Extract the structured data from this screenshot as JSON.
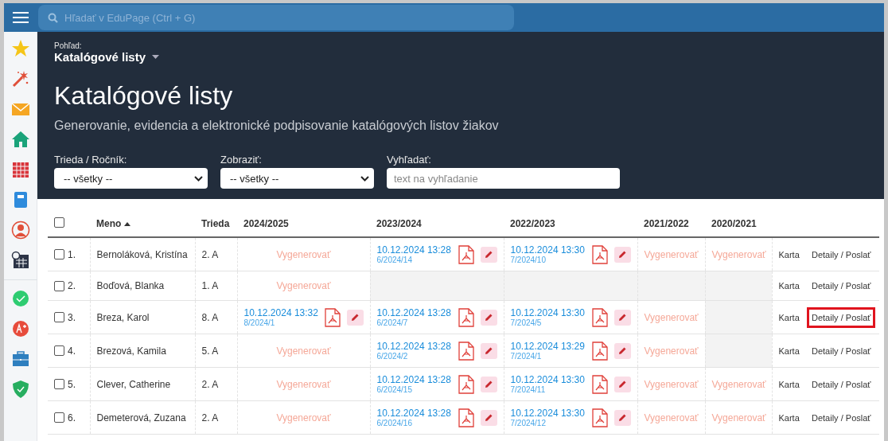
{
  "search": {
    "placeholder": "Hľadať v EduPage (Ctrl + G)"
  },
  "view": {
    "label": "Pohľad:",
    "value": "Katalógové listy"
  },
  "title": "Katalógové listy",
  "subtitle": "Generovanie, evidencia a elektronické podpisovanie katalógových listov žiakov",
  "filters": [
    {
      "kind": "select",
      "label": "Trieda / Ročník:",
      "value": "-- všetky --"
    },
    {
      "kind": "select",
      "label": "Zobraziť:",
      "value": "-- všetky --"
    },
    {
      "kind": "text",
      "label": "Vyhľadať:",
      "placeholder": "text na vyhľadanie"
    }
  ],
  "table": {
    "select_all": {
      "checked": false
    },
    "columns": [
      {
        "label": "Meno",
        "sorted": true
      },
      {
        "label": "Trieda",
        "sorted": false
      },
      {
        "label": "2024/2025",
        "sorted": false
      },
      {
        "label": "2023/2024",
        "sorted": false
      },
      {
        "label": "2022/2023",
        "sorted": false
      },
      {
        "label": "2021/2022",
        "sorted": false
      },
      {
        "label": "2020/2021",
        "sorted": false
      }
    ],
    "rows": [
      {
        "checked": false,
        "number": "1.",
        "name": "Bernoláková, Kristína",
        "class": "2. A",
        "years": [
          {
            "kind": "generate",
            "text": "Vygenerovať"
          },
          {
            "kind": "signed",
            "date": "10.12.2024 13:28",
            "ref": "6/2024/14"
          },
          {
            "kind": "signed",
            "date": "10.12.2024 13:30",
            "ref": "7/2024/10"
          },
          {
            "kind": "generate",
            "text": "Vygenerovať"
          },
          {
            "kind": "generate",
            "text": "Vygenerovať"
          }
        ],
        "card": "Karta",
        "details": "Detaily / Poslať",
        "highlighted": false
      },
      {
        "checked": false,
        "number": "2.",
        "name": "Boďová, Blanka",
        "class": "1. A",
        "years": [
          {
            "kind": "generate",
            "text": "Vygenerovať"
          },
          {
            "kind": "empty"
          },
          {
            "kind": "empty"
          },
          {
            "kind": "empty"
          },
          {
            "kind": "empty"
          }
        ],
        "card": "Karta",
        "details": "Detaily / Poslať",
        "highlighted": false
      },
      {
        "checked": false,
        "number": "3.",
        "name": "Breza, Karol",
        "class": "8. A",
        "years": [
          {
            "kind": "signed",
            "date": "10.12.2024 13:32",
            "ref": "8/2024/1"
          },
          {
            "kind": "signed",
            "date": "10.12.2024 13:28",
            "ref": "6/2024/7"
          },
          {
            "kind": "signed",
            "date": "10.12.2024 13:30",
            "ref": "7/2024/5"
          },
          {
            "kind": "generate",
            "text": "Vygenerovať"
          },
          {
            "kind": "empty"
          }
        ],
        "card": "Karta",
        "details": "Detaily / Poslať",
        "highlighted": true
      },
      {
        "checked": false,
        "number": "4.",
        "name": "Brezová, Kamila",
        "class": "5. A",
        "years": [
          {
            "kind": "generate",
            "text": "Vygenerovať"
          },
          {
            "kind": "signed",
            "date": "10.12.2024 13:28",
            "ref": "6/2024/2"
          },
          {
            "kind": "signed",
            "date": "10.12.2024 13:29",
            "ref": "7/2024/1"
          },
          {
            "kind": "generate",
            "text": "Vygenerovať"
          },
          {
            "kind": "empty"
          }
        ],
        "card": "Karta",
        "details": "Detaily / Poslať",
        "highlighted": false
      },
      {
        "checked": false,
        "number": "5.",
        "name": "Clever, Catherine",
        "class": "2. A",
        "years": [
          {
            "kind": "generate",
            "text": "Vygenerovať"
          },
          {
            "kind": "signed",
            "date": "10.12.2024 13:28",
            "ref": "6/2024/15"
          },
          {
            "kind": "signed",
            "date": "10.12.2024 13:30",
            "ref": "7/2024/11"
          },
          {
            "kind": "generate",
            "text": "Vygenerovať"
          },
          {
            "kind": "generate",
            "text": "Vygenerovať"
          }
        ],
        "card": "Karta",
        "details": "Detaily / Poslať",
        "highlighted": false
      },
      {
        "checked": false,
        "number": "6.",
        "name": "Demeterová, Zuzana",
        "class": "2. A",
        "years": [
          {
            "kind": "generate",
            "text": "Vygenerovať"
          },
          {
            "kind": "signed",
            "date": "10.12.2024 13:28",
            "ref": "6/2024/16"
          },
          {
            "kind": "signed",
            "date": "10.12.2024 13:30",
            "ref": "7/2024/12"
          },
          {
            "kind": "generate",
            "text": "Vygenerovať"
          },
          {
            "kind": "generate",
            "text": "Vygenerovať"
          }
        ],
        "card": "Karta",
        "details": "Detaily / Poslať",
        "highlighted": false
      }
    ]
  }
}
